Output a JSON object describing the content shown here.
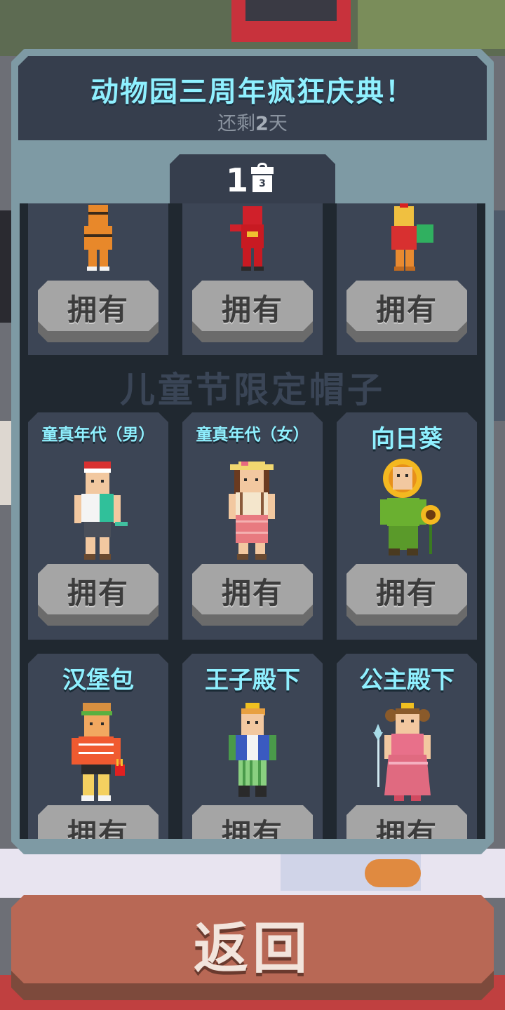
{
  "event": {
    "title": "动物园三周年疯狂庆典！",
    "subtitle_prefix": "还剩",
    "subtitle_days": "2",
    "subtitle_suffix": "天"
  },
  "tab": {
    "number": "1",
    "gift_number": "3"
  },
  "section_title": "儿童节限定帽子",
  "top_row": [
    {
      "button": "拥有",
      "icon": "tiger-costume-character"
    },
    {
      "button": "拥有",
      "icon": "red-hero-character"
    },
    {
      "button": "拥有",
      "icon": "rooster-costume-character"
    }
  ],
  "hats_row1": [
    {
      "title": "童真年代（男）",
      "button": "拥有",
      "icon": "boy-character"
    },
    {
      "title": "童真年代（女）",
      "button": "拥有",
      "icon": "girl-character"
    },
    {
      "title": "向日葵",
      "button": "拥有",
      "icon": "sunflower-character"
    }
  ],
  "hats_row2": [
    {
      "title": "汉堡包",
      "button": "拥有",
      "icon": "burger-character"
    },
    {
      "title": "王子殿下",
      "button": "拥有",
      "icon": "prince-character"
    },
    {
      "title": "公主殿下",
      "button": "拥有",
      "icon": "princess-character"
    }
  ],
  "back_button": "返回",
  "colors": {
    "accent_text": "#8ff0ff",
    "panel": "#7e9aa4",
    "card": "#3c4555",
    "back_button": "#b86855"
  }
}
